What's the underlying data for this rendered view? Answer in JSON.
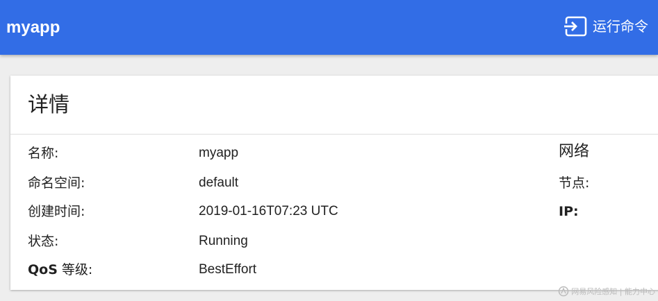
{
  "header": {
    "app_title": "myapp",
    "exec_label": "运行命令",
    "background_color": "#326de6"
  },
  "details": {
    "title": "详情",
    "rows": [
      {
        "label": "名称:",
        "value": "myapp"
      },
      {
        "label": "命名空间:",
        "value": "default"
      },
      {
        "label": "创建时间:",
        "value": "2019-01-16T07:23 UTC"
      },
      {
        "label": "状态:",
        "value": "Running"
      },
      {
        "label_prefix": "QoS",
        "label_suffix": " 等级:",
        "value": "BestEffort"
      }
    ],
    "network": {
      "heading": "网络",
      "node_label": "节点:",
      "ip_label": "IP:"
    }
  },
  "watermark": {
    "text": "网易风险感知 | 能力中心"
  }
}
